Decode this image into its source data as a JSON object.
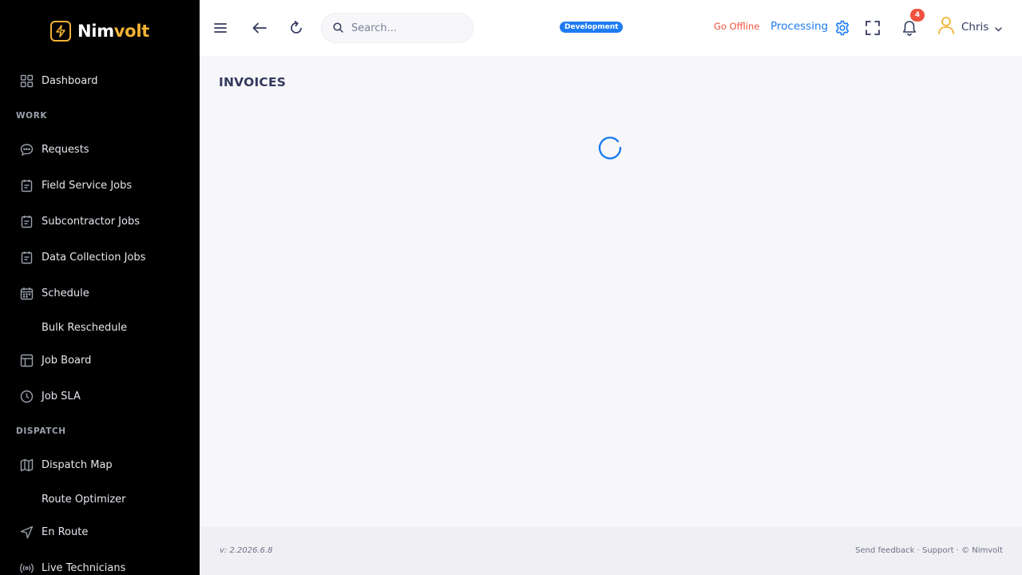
{
  "brand": {
    "name_part1": "Nim",
    "name_part2": "volt",
    "accent": "#f2b233"
  },
  "sidebar": {
    "sections": {
      "work": "WORK",
      "dispatch": "DISPATCH"
    },
    "items": [
      {
        "label": "Dashboard",
        "icon": "grid-icon"
      },
      {
        "label": "Requests",
        "icon": "chat-icon"
      },
      {
        "label": "Field Service Jobs",
        "icon": "clipboard-icon"
      },
      {
        "label": "Subcontractor Jobs",
        "icon": "clipboard-icon"
      },
      {
        "label": "Data Collection Jobs",
        "icon": "clipboard-icon"
      },
      {
        "label": "Schedule",
        "icon": "calendar-icon"
      },
      {
        "label": "Bulk Reschedule",
        "icon": ""
      },
      {
        "label": "Job Board",
        "icon": "board-icon"
      },
      {
        "label": "Job SLA",
        "icon": "clock-icon"
      },
      {
        "label": "Dispatch Map",
        "icon": "map-icon"
      },
      {
        "label": "Route Optimizer",
        "icon": ""
      },
      {
        "label": "En Route",
        "icon": "navigation-icon"
      },
      {
        "label": "Live Technicians",
        "icon": "broadcast-icon"
      }
    ]
  },
  "header": {
    "search": {
      "placeholder": "Search..."
    },
    "environment_badge": "Development",
    "go_offline": "Go Offline",
    "processing": "Processing",
    "notifications_count": "4",
    "user_name": "Chris",
    "accent_color": "#1e7bf2",
    "danger_color": "#f0523f"
  },
  "main": {
    "title": "INVOICES"
  },
  "footer": {
    "version": "v: 2.2026.6.8",
    "send_feedback": "Send feedback",
    "support": "Support",
    "copyright": "© Nimvolt"
  }
}
